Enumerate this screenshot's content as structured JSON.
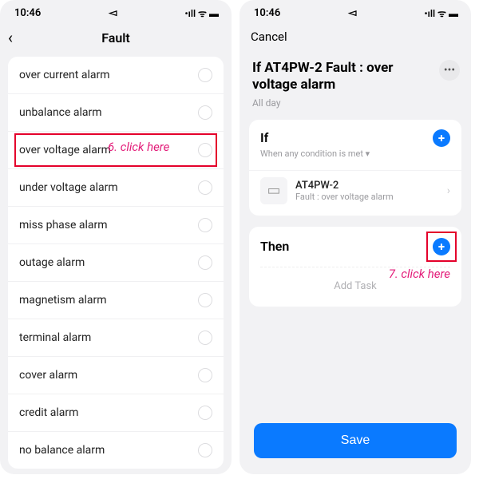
{
  "status": {
    "time": "10:46",
    "loc": "◅",
    "icons": "•ıll ᯤ ▬"
  },
  "left": {
    "title": "Fault",
    "items": [
      "over current alarm",
      "unbalance alarm",
      "over voltage alarm",
      "under voltage alarm",
      "miss phase alarm",
      "outage alarm",
      "magnetism alarm",
      "terminal alarm",
      "cover alarm",
      "credit alarm",
      "no balance alarm"
    ],
    "annotation": "6. click here"
  },
  "right": {
    "cancel": "Cancel",
    "header_title": "If AT4PW-2 Fault : over voltage alarm",
    "header_sub": "All day",
    "if": {
      "title": "If",
      "sub": "When any condition is met ▾",
      "device_name": "AT4PW-2",
      "device_desc": "Fault : over voltage alarm"
    },
    "then": {
      "title": "Then",
      "add_task": "Add Task",
      "annotation": "7. click here"
    },
    "save": "Save"
  }
}
